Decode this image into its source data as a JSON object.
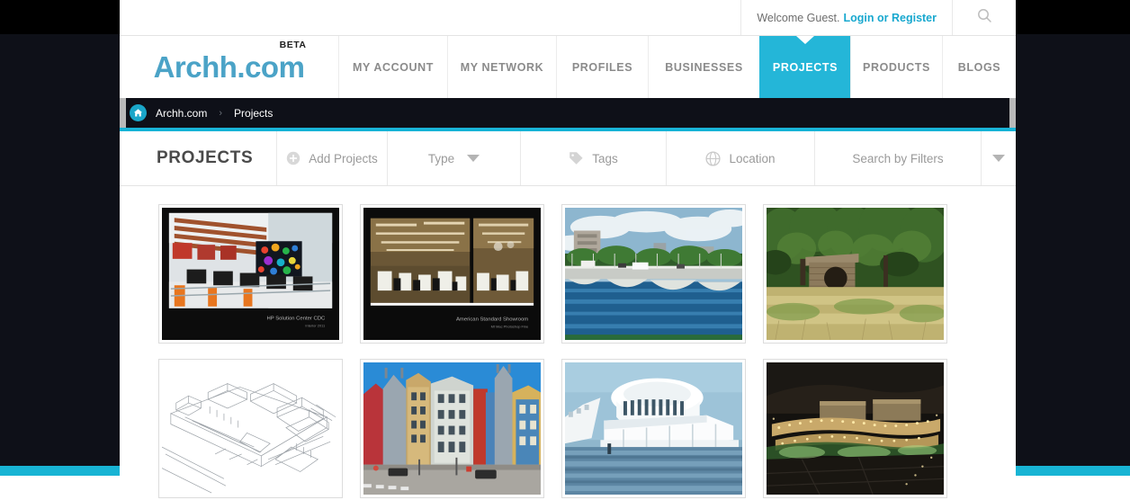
{
  "utility": {
    "welcome_text": "Welcome Guest.",
    "login_label": "Login or Register",
    "search_icon": "search-icon"
  },
  "brand": {
    "wordmark": "Archh.com",
    "badge": "BETA"
  },
  "nav": {
    "items": [
      {
        "label": "MY ACCOUNT",
        "active": false
      },
      {
        "label": "MY NETWORK",
        "active": false
      },
      {
        "label": "PROFILES",
        "active": false
      },
      {
        "label": "BUSINESSES",
        "active": false
      },
      {
        "label": "PROJECTS",
        "active": true
      },
      {
        "label": "PRODUCTS",
        "active": false
      },
      {
        "label": "BLOGS",
        "active": false
      }
    ]
  },
  "breadcrumb": {
    "home_icon": "home-icon",
    "root": "Archh.com",
    "separator": "›",
    "current": "Projects"
  },
  "toolbar": {
    "title": "PROJECTS",
    "add_label": "Add Projects",
    "add_icon": "plus-circle-icon",
    "type_label": "Type",
    "tags_label": "Tags",
    "tags_icon": "tag-icon",
    "location_label": "Location",
    "location_icon": "globe-icon",
    "filters_label": "Search by Filters",
    "caret_icon": "chevron-down-icon"
  },
  "projects": [
    {
      "id": "p1",
      "caption": "HP Solution Center CDC",
      "kind": "interior-showroom-dark"
    },
    {
      "id": "p2",
      "caption": "American Standard Showroom",
      "kind": "showroom-split-dark"
    },
    {
      "id": "p3",
      "caption": "",
      "kind": "bridge-river"
    },
    {
      "id": "p4",
      "caption": "",
      "kind": "wooden-cabin-meadow"
    },
    {
      "id": "p5",
      "caption": "",
      "kind": "line-drawing-complex"
    },
    {
      "id": "p6",
      "caption": "",
      "kind": "street-buildings"
    },
    {
      "id": "p7",
      "caption": "",
      "kind": "white-terminal-water"
    },
    {
      "id": "p8",
      "caption": "",
      "kind": "night-aerial-lights"
    }
  ],
  "colors": {
    "accent_cyan": "#18b4d4",
    "nav_active": "#24b6d8",
    "brand_blue": "#4ba3c7",
    "page_dark": "#0e1018",
    "link_blue": "#18a8cf"
  }
}
